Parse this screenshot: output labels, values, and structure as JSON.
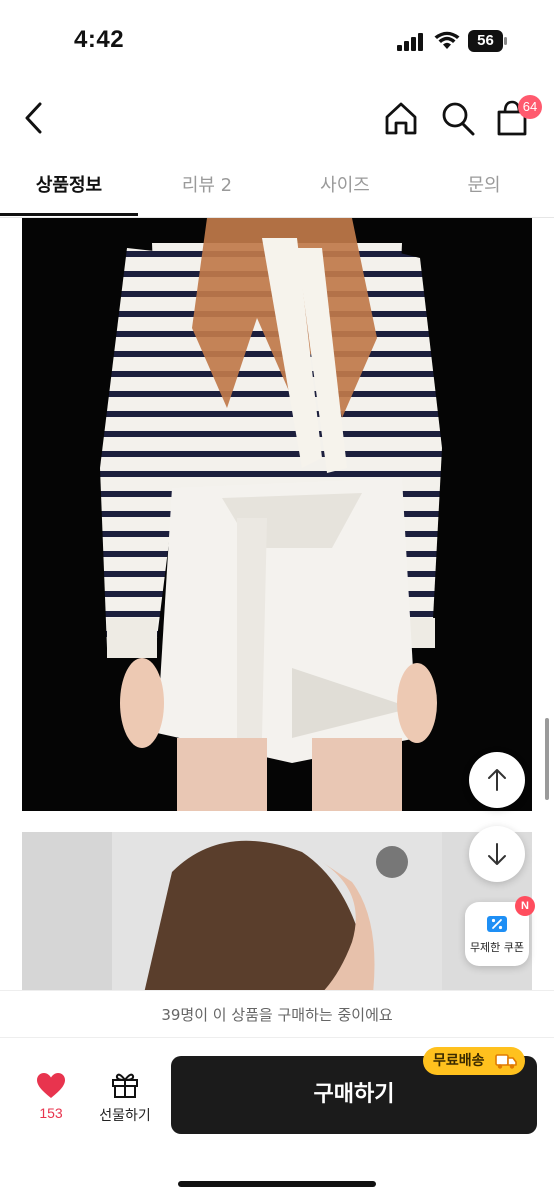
{
  "status_bar": {
    "time": "4:42",
    "battery": "56"
  },
  "header": {
    "back_icon": "chevron-left-icon",
    "home_icon": "home-icon",
    "search_icon": "search-icon",
    "cart_icon": "shopping-bag-icon",
    "cart_count": "64"
  },
  "tabs": [
    {
      "label": "상품정보",
      "active": true
    },
    {
      "label": "리뷰 2",
      "active": false
    },
    {
      "label": "사이즈",
      "active": false
    },
    {
      "label": "문의",
      "active": false
    }
  ],
  "floating": {
    "up_icon": "arrow-up-icon",
    "down_icon": "arrow-down-icon",
    "coupon_label": "무제한 쿠폰",
    "coupon_new_badge": "N"
  },
  "buyers_text": "39명이 이 상품을 구매하는 중이에요",
  "bottom_bar": {
    "like_count": "153",
    "gift_label": "선물하기",
    "buy_label": "구매하기",
    "shipping_badge": "무료배송"
  },
  "colors": {
    "accent_red": "#ff5a6e",
    "like_red": "#e8344e",
    "shipping_yellow": "#ffc11e",
    "buy_button": "#1b1b1b"
  }
}
